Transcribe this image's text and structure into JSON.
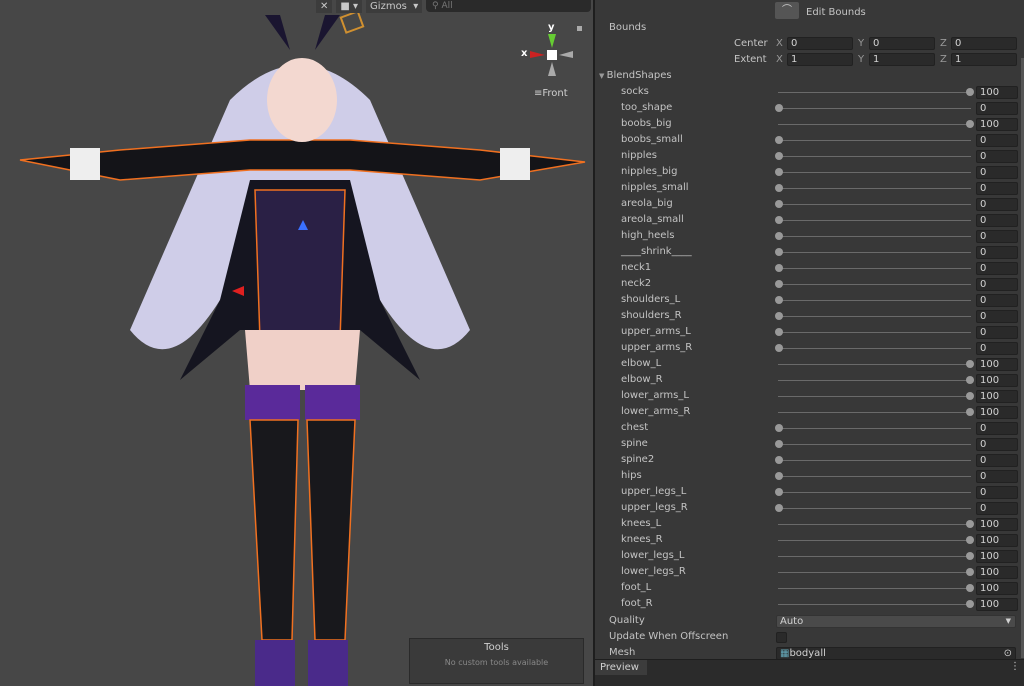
{
  "scene": {
    "toolbar": {
      "gizmos_label": "Gizmos",
      "search_placeholder": "All"
    },
    "gizmo": {
      "x_label": "x",
      "y_label": "y",
      "view_label": "Front"
    },
    "tools": {
      "title": "Tools",
      "subtitle": "No custom tools available"
    }
  },
  "inspector": {
    "edit_bounds_label": "Edit Bounds",
    "bounds": {
      "label": "Bounds",
      "center_label": "Center",
      "extent_label": "Extent",
      "axis": [
        "X",
        "Y",
        "Z"
      ],
      "center": [
        "0",
        "0",
        "0"
      ],
      "extent": [
        "1",
        "1",
        "1"
      ]
    },
    "blendshapes_label": "BlendShapes",
    "blendshapes": [
      {
        "name": "socks",
        "value": 100
      },
      {
        "name": "too_shape",
        "value": 0
      },
      {
        "name": "boobs_big",
        "value": 100
      },
      {
        "name": "boobs_small",
        "value": 0
      },
      {
        "name": "nipples",
        "value": 0
      },
      {
        "name": "nipples_big",
        "value": 0
      },
      {
        "name": "nipples_small",
        "value": 0
      },
      {
        "name": "areola_big",
        "value": 0
      },
      {
        "name": "areola_small",
        "value": 0
      },
      {
        "name": "high_heels",
        "value": 0
      },
      {
        "name": "____shrink____",
        "value": 0
      },
      {
        "name": "neck1",
        "value": 0
      },
      {
        "name": "neck2",
        "value": 0
      },
      {
        "name": "shoulders_L",
        "value": 0
      },
      {
        "name": "shoulders_R",
        "value": 0
      },
      {
        "name": "upper_arms_L",
        "value": 0
      },
      {
        "name": "upper_arms_R",
        "value": 0
      },
      {
        "name": "elbow_L",
        "value": 100
      },
      {
        "name": "elbow_R",
        "value": 100
      },
      {
        "name": "lower_arms_L",
        "value": 100
      },
      {
        "name": "lower_arms_R",
        "value": 100
      },
      {
        "name": "chest",
        "value": 0
      },
      {
        "name": "spine",
        "value": 0
      },
      {
        "name": "spine2",
        "value": 0
      },
      {
        "name": "hips",
        "value": 0
      },
      {
        "name": "upper_legs_L",
        "value": 0
      },
      {
        "name": "upper_legs_R",
        "value": 0
      },
      {
        "name": "knees_L",
        "value": 100
      },
      {
        "name": "knees_R",
        "value": 100
      },
      {
        "name": "lower_legs_L",
        "value": 100
      },
      {
        "name": "lower_legs_R",
        "value": 100
      },
      {
        "name": "foot_L",
        "value": 100
      },
      {
        "name": "foot_R",
        "value": 100
      }
    ],
    "quality_label": "Quality",
    "quality_value": "Auto",
    "update_offscreen_label": "Update When Offscreen",
    "update_offscreen_checked": false,
    "mesh_label": "Mesh",
    "mesh_value": "bodyall"
  },
  "preview": {
    "tab_label": "Preview"
  }
}
